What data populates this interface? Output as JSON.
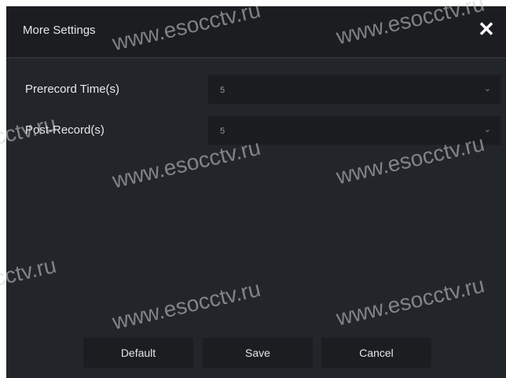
{
  "dialog": {
    "title": "More Settings",
    "close_icon": "close-icon"
  },
  "form": {
    "prerecord_label": "Prerecord Time(s)",
    "prerecord_value": "5",
    "postrecord_label": "Post-Record(s)",
    "postrecord_value": "5"
  },
  "buttons": {
    "default_label": "Default",
    "save_label": "Save",
    "cancel_label": "Cancel"
  },
  "watermark": {
    "text": "www.esocctv.ru"
  },
  "colors": {
    "background": "#22252a",
    "header": "#1b1d21",
    "field": "#1a1c20",
    "text": "#e6e6e6"
  }
}
